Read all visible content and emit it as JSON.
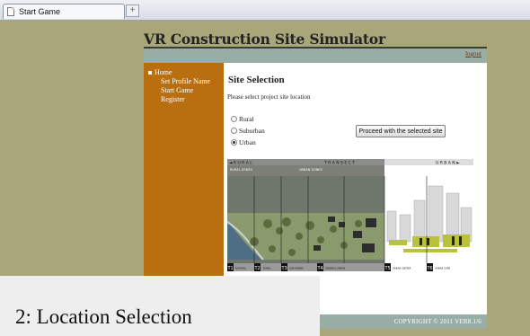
{
  "browser": {
    "tab_title": "Start Game",
    "new_tab_symbol": "+"
  },
  "site": {
    "title": "VR Construction Site Simulator",
    "logout_label": "logout",
    "footer_text": "COPYRIGHT © 2011 VER8.1/6"
  },
  "sidebar": {
    "items": [
      {
        "label": "Home"
      },
      {
        "label": "Set Profile Name"
      },
      {
        "label": "Start Game"
      },
      {
        "label": "Register"
      }
    ]
  },
  "main": {
    "heading": "Site Selection",
    "prompt": "Please select project site location",
    "options": [
      {
        "label": "Rural",
        "checked": false
      },
      {
        "label": "Suburban",
        "checked": false
      },
      {
        "label": "Urban",
        "checked": true
      }
    ],
    "proceed_label": "Proceed with the selected site"
  },
  "transect": {
    "header_left": "◄ R U R A L",
    "header_mid": "T R A N S E C T",
    "header_right": "U R B A N ►",
    "zone_left": "RURAL ZONES",
    "zone_mid": "URBAN ZONES",
    "panels": [
      {
        "code": "T1",
        "name": "NATURAL"
      },
      {
        "code": "T2",
        "name": "RURAL"
      },
      {
        "code": "T3",
        "name": "SUB-URBAN"
      },
      {
        "code": "T4",
        "name": "GENERAL URBAN"
      },
      {
        "code": "T5",
        "name": "URBAN CENTER"
      },
      {
        "code": "T6",
        "name": "URBAN CORE"
      }
    ]
  },
  "caption": "2: Location Selection",
  "colors": {
    "page_bg": "#a9a77a",
    "sidebar": "#b96e0f",
    "bar": "#98ada6"
  }
}
